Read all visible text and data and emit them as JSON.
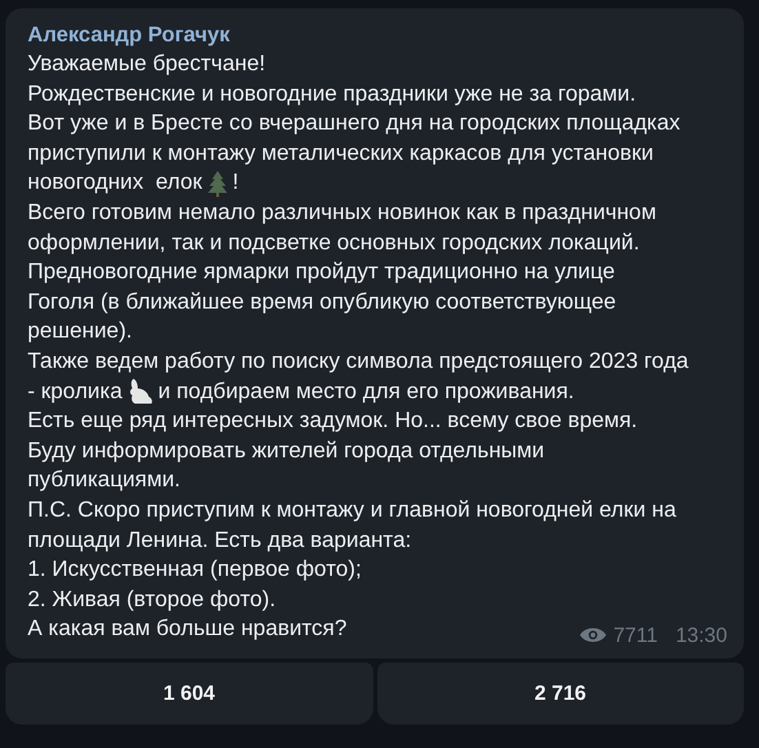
{
  "message": {
    "author": "Александр Рогачук",
    "lines": [
      [
        {
          "text": "Уважаемые брестчане!"
        }
      ],
      [
        {
          "text": "Рождественские и новогодние праздники уже не за горами."
        }
      ],
      [
        {
          "text": "Вот уже и в Бресте со вчерашнего дня на городских площадках"
        }
      ],
      [
        {
          "text": "приступили к монтажу металических каркасов для установки"
        }
      ],
      [
        {
          "text": "новогодних  елок"
        },
        {
          "kind": "tree"
        },
        {
          "text": "!"
        }
      ],
      [
        {
          "text": "Всего готовим немало различных новинок как в праздничном"
        }
      ],
      [
        {
          "text": "оформлении, так и подсветке основных городских локаций."
        }
      ],
      [
        {
          "text": "Предновогодние ярмарки пройдут традиционно на улице"
        }
      ],
      [
        {
          "text": "Гоголя (в ближайшее время опубликую соответствующее"
        }
      ],
      [
        {
          "text": "решение)."
        }
      ],
      [
        {
          "text": "Также ведем работу по поиску символа предстоящего 2023 года"
        }
      ],
      [
        {
          "text": "- кролика"
        },
        {
          "kind": "rabbit"
        },
        {
          "text": "и подбираем место для его проживания."
        }
      ],
      [
        {
          "text": "Есть еще ряд интересных задумок. Но... всему свое время."
        }
      ],
      [
        {
          "text": "Буду информировать жителей города отдельными"
        }
      ],
      [
        {
          "text": "публикациями."
        }
      ],
      [
        {
          "text": "П.С. Скоро приступим к монтажу и главной новогодней елки на"
        }
      ],
      [
        {
          "text": "площади Ленина. Есть два варианта:"
        }
      ],
      [
        {
          "text": "1. Искусственная (первое фото);"
        }
      ],
      [
        {
          "text": "2. Живая (второе фото)."
        }
      ],
      [
        {
          "text": "А какая вам больше нравится?"
        }
      ]
    ],
    "views": "7711",
    "time": "13:30"
  },
  "buttons": [
    "1 604",
    "2 716"
  ]
}
